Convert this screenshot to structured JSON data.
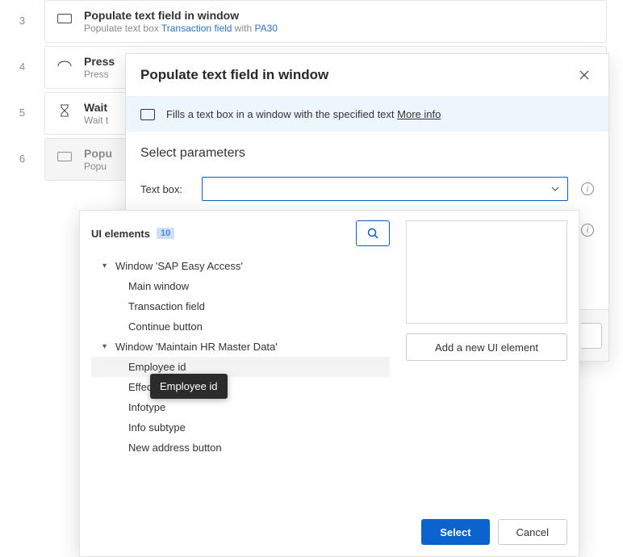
{
  "flow": {
    "steps": [
      {
        "num": "3",
        "title": "Populate text field in window",
        "desc_prefix": "Populate text box ",
        "desc_link": "Transaction field",
        "desc_mid": " with ",
        "desc_link2": "PA30"
      },
      {
        "num": "4",
        "title": "Press",
        "desc_prefix": "Press"
      },
      {
        "num": "5",
        "title": "Wait",
        "desc_prefix": "Wait t"
      },
      {
        "num": "6",
        "title": "Popu",
        "desc_prefix": "Popu"
      }
    ]
  },
  "dialog": {
    "title": "Populate text field in window",
    "banner_text": "Fills a text box in a window with the specified text ",
    "banner_more": "More info",
    "params_title": "Select parameters",
    "textbox_label": "Text box:"
  },
  "ui_popup": {
    "header": "UI elements",
    "count": "10",
    "groups": [
      {
        "label": "Window 'SAP Easy Access'",
        "children": [
          "Main window",
          "Transaction field",
          "Continue button"
        ]
      },
      {
        "label": "Window 'Maintain HR Master Data'",
        "children": [
          "Employee id",
          "Effecti",
          "Infotype",
          "Info subtype",
          "New address button"
        ]
      }
    ],
    "selected": "Employee id",
    "tooltip": "Employee id",
    "add_btn": "Add a new UI element",
    "select_btn": "Select",
    "cancel_btn": "Cancel"
  }
}
